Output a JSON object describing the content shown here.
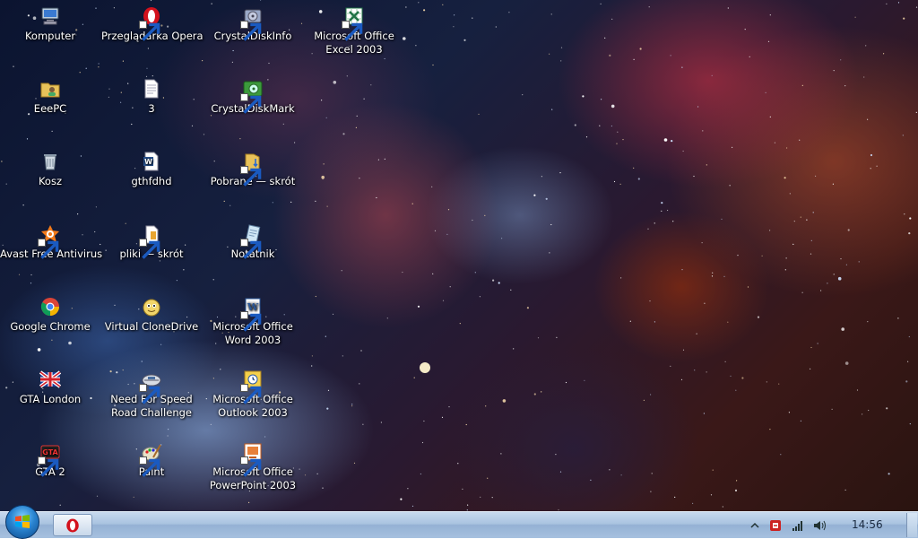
{
  "desktop": {
    "icons": [
      {
        "label": "Komputer",
        "icon": "computer-icon"
      },
      {
        "label": "EeePC",
        "icon": "user-folder-icon"
      },
      {
        "label": "Kosz",
        "icon": "recycle-bin-icon"
      },
      {
        "label": "Avast Free Antivirus",
        "icon": "avast-icon"
      },
      {
        "label": "Google Chrome",
        "icon": "chrome-icon"
      },
      {
        "label": "GTA London",
        "icon": "gta-london-icon"
      },
      {
        "label": "GTA 2",
        "icon": "gta2-icon"
      },
      {
        "label": "Przeglądarka Opera",
        "icon": "opera-icon"
      },
      {
        "label": "3",
        "icon": "text-document-icon"
      },
      {
        "label": "gthfdhd",
        "icon": "word-document-icon"
      },
      {
        "label": "pliki — skrót",
        "icon": "folder-shortcut-icon"
      },
      {
        "label": "Virtual CloneDrive",
        "icon": "clonedrive-icon"
      },
      {
        "label": "Need For Speed Road Challenge",
        "label2": "Road Challenge",
        "label1": "Need For Speed",
        "icon": "nfs-icon"
      },
      {
        "label": "Paint",
        "icon": "paint-icon"
      },
      {
        "label": "CrystalDiskInfo",
        "icon": "crystaldiskinfo-icon"
      },
      {
        "label": "CrystalDiskMark",
        "icon": "crystaldiskmark-icon"
      },
      {
        "label": "Pobrane — skrót",
        "icon": "downloads-folder-icon"
      },
      {
        "label": "Notatnik",
        "icon": "notepad-icon"
      },
      {
        "label1": "Microsoft Office",
        "label2": "Word 2003",
        "icon": "word-icon"
      },
      {
        "label1": "Microsoft Office",
        "label2": "Outlook 2003",
        "icon": "outlook-icon"
      },
      {
        "label1": "Microsoft Office",
        "label2": "PowerPoint 2003",
        "icon": "powerpoint-icon"
      },
      {
        "label1": "Microsoft Office",
        "label2": "Excel 2003",
        "icon": "excel-icon"
      }
    ]
  },
  "taskbar": {
    "start": "start-orb-icon",
    "pinned": [
      "opera-icon"
    ],
    "tray": [
      "show-hidden-icons-icon",
      "avast-tray-icon",
      "network-icon",
      "volume-icon"
    ],
    "clock": "14:56"
  },
  "colors": {
    "taskbar": "#a9c3e0",
    "label_text": "#ffffff"
  }
}
